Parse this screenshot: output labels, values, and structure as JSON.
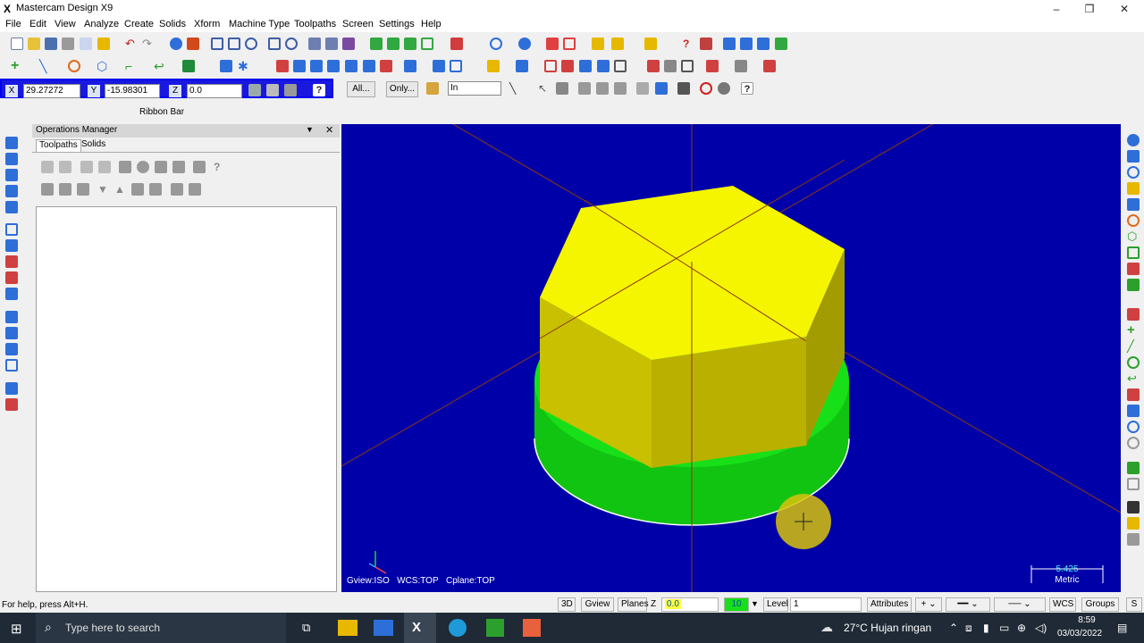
{
  "app": {
    "title": "Mastercam Design X9"
  },
  "menu": [
    "File",
    "Edit",
    "View",
    "Analyze",
    "Create",
    "Solids",
    "Xform",
    "Machine Type",
    "Toolpaths",
    "Screen",
    "Settings",
    "Help"
  ],
  "ribbon": {
    "x_label": "X",
    "x_value": "29.27272",
    "y_label": "Y",
    "y_value": "-15.98301",
    "z_label": "Z",
    "z_value": "0.0",
    "all_btn": "All...",
    "only_btn": "Only...",
    "select_mode": "In",
    "bar_label": "Ribbon Bar"
  },
  "ops_manager": {
    "title": "Operations Manager",
    "tabs": [
      "Toolpaths",
      "Solids"
    ]
  },
  "viewport": {
    "gview": "Gview:ISO",
    "wcs": "WCS:TOP",
    "cplane": "Cplane:TOP",
    "scale_value": "5.425",
    "scale_unit": "Metric",
    "colors": {
      "background": "#0000a8",
      "hex_top": "#f4f400",
      "hex_side": "#c9c000",
      "base": "#14d814"
    }
  },
  "status": {
    "help": "For help, press Alt+H.",
    "btn_3d": "3D",
    "btn_gview": "Gview",
    "btn_planes": "Planes",
    "z_label": "Z",
    "z_value": "0.0",
    "color_num": "10",
    "level_label": "Level",
    "level_value": "1",
    "attributes": "Attributes",
    "wcs": "WCS",
    "groups": "Groups"
  },
  "taskbar": {
    "search_placeholder": "Type here to search",
    "weather": "27°C  Hujan ringan",
    "time": "8:59",
    "date": "03/03/2022"
  }
}
